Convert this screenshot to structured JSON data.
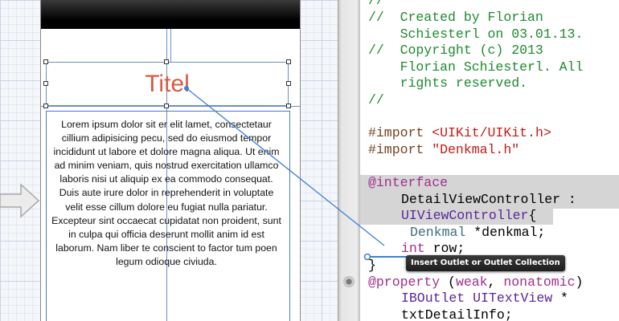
{
  "storyboard": {
    "title_label": "Titel",
    "body_text": "Lorem ipsum dolor sit er elit lamet, consectetaur cillium adipisicing pecu, sed do eiusmod tempor incididunt ut labore et dolore magna aliqua. Ut enim ad minim veniam, quis nostrud exercitation ullamco laboris nisi ut aliquip ex ea commodo consequat. Duis aute irure dolor in reprehenderit in voluptate velit esse cillum dolore eu fugiat nulla pariatur. Excepteur sint occaecat cupidatat non proident, sunt in culpa qui officia deserunt mollit anim id est laborum. Nam liber te conscient to factor tum poen legum odioque civiuda."
  },
  "code": {
    "comment_1": "//",
    "comment_2a": "//  Created by Florian",
    "comment_2b": "    Schiesterl on 03.01.13.",
    "comment_3a": "//  Copyright (c) 2013",
    "comment_3b": "    Florian Schiesterl. All",
    "comment_3c": "    rights reserved.",
    "comment_4": "//",
    "import_1_kw": "#import ",
    "import_1_path": "<UIKit/UIKit.h>",
    "import_2_kw": "#import ",
    "import_2_path": "\"Denkmal.h\"",
    "interface_kw": "@interface",
    "class_name": "DetailViewController :",
    "superclass": "UIViewController",
    "brace_open": "{",
    "ivar_1_type": "Denkmal",
    "ivar_1_name": " *denkmal;",
    "ivar_2_type": "int",
    "ivar_2_name": " row;",
    "brace_close": "}",
    "property_kw": "@property",
    "property_attrs_open": " (",
    "attr_weak": "weak",
    "attr_sep": ", ",
    "attr_nonatomic": "nonatomic",
    "property_attrs_close": ")",
    "iboutlet_kw": "IBOutlet",
    "property_type": " UITextView",
    "property_ptr": " *",
    "property_name": "txtDetailInfo;"
  },
  "tooltip": {
    "text": "Insert Outlet or Outlet Collection"
  },
  "colors": {
    "connection_line": "#3f7fd8",
    "comment": "#1e8a2f",
    "keyword": "#a02e8e",
    "string": "#c41a16",
    "title_label": "#d85a45"
  }
}
